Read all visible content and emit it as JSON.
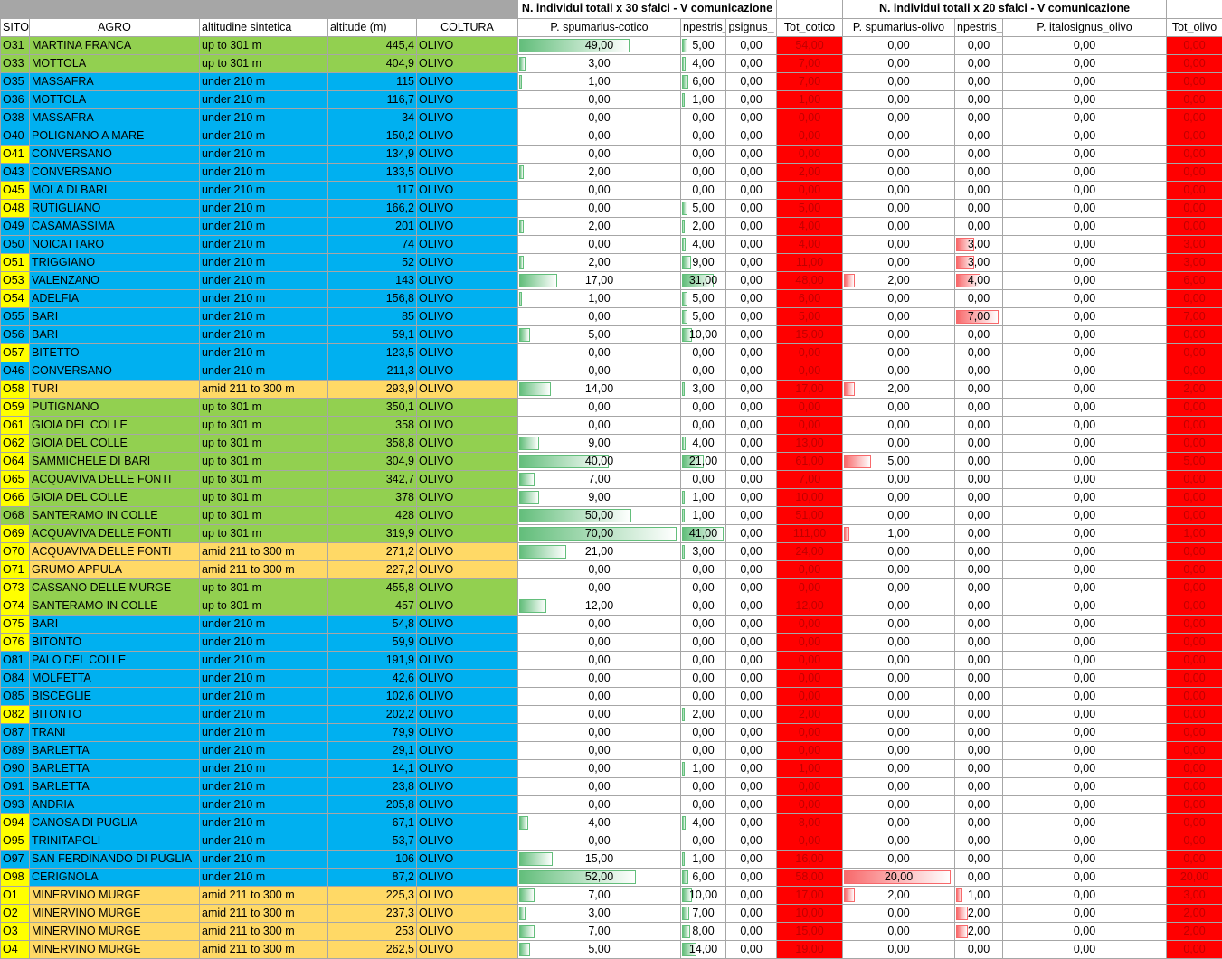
{
  "group_headers": {
    "cotico": "N. individui totali x 30 sfalci - V comunicazione",
    "olivo": "N. individui totali x 20 sfalci - V comunicazione"
  },
  "columns": [
    "SITO",
    "AGRO",
    "altitudine sintetica",
    "altitude (m)",
    "COLTURA",
    "P. spumarius-cotico",
    "npestris_",
    "psignus_",
    "Tot_cotico",
    "P. spumarius-olivo",
    "npestris_",
    "P. italosignus_olivo",
    "Tot_olivo"
  ],
  "colors": {
    "green": "#92d050",
    "blue": "#00b0f0",
    "orange": "#ffd966",
    "yellow": "#ffff00",
    "red": "#ff0000"
  },
  "bar_max": {
    "spc": 70,
    "c2": 41,
    "spo": 20,
    "o2": 7
  },
  "rows": [
    {
      "sito": "O31",
      "agro": "MARTINA FRANCA",
      "alt": "up to 301 m",
      "m": "445,4",
      "colt": "OLIVO",
      "spc": "49,00",
      "c2": "5,00",
      "c3": "0,00",
      "tc": "54,00",
      "spo": "0,00",
      "o2": "0,00",
      "o3": "0,00",
      "to": "0,00",
      "color": "green",
      "sc": "green"
    },
    {
      "sito": "O33",
      "agro": "MOTTOLA",
      "alt": "up to 301 m",
      "m": "404,9",
      "colt": "OLIVO",
      "spc": "3,00",
      "c2": "4,00",
      "c3": "0,00",
      "tc": "7,00",
      "spo": "0,00",
      "o2": "0,00",
      "o3": "0,00",
      "to": "0,00",
      "color": "green",
      "sc": "green"
    },
    {
      "sito": "O35",
      "agro": "MASSAFRA",
      "alt": "under 210 m",
      "m": "115",
      "colt": "OLIVO",
      "spc": "1,00",
      "c2": "6,00",
      "c3": "0,00",
      "tc": "7,00",
      "spo": "0,00",
      "o2": "0,00",
      "o3": "0,00",
      "to": "0,00",
      "color": "blue",
      "sc": "blue"
    },
    {
      "sito": "O36",
      "agro": "MOTTOLA",
      "alt": "under 210 m",
      "m": "116,7",
      "colt": "OLIVO",
      "spc": "0,00",
      "c2": "1,00",
      "c3": "0,00",
      "tc": "1,00",
      "spo": "0,00",
      "o2": "0,00",
      "o3": "0,00",
      "to": "0,00",
      "color": "blue",
      "sc": "blue"
    },
    {
      "sito": "O38",
      "agro": "MASSAFRA",
      "alt": "under 210 m",
      "m": "34",
      "colt": "OLIVO",
      "spc": "0,00",
      "c2": "0,00",
      "c3": "0,00",
      "tc": "0,00",
      "spo": "0,00",
      "o2": "0,00",
      "o3": "0,00",
      "to": "0,00",
      "color": "blue",
      "sc": "blue"
    },
    {
      "sito": "O40",
      "agro": "POLIGNANO A MARE",
      "alt": "under 210 m",
      "m": "150,2",
      "colt": "OLIVO",
      "spc": "0,00",
      "c2": "0,00",
      "c3": "0,00",
      "tc": "0,00",
      "spo": "0,00",
      "o2": "0,00",
      "o3": "0,00",
      "to": "0,00",
      "color": "blue",
      "sc": "blue"
    },
    {
      "sito": "O41",
      "agro": "CONVERSANO",
      "alt": "under 210 m",
      "m": "134,9",
      "colt": "OLIVO",
      "spc": "0,00",
      "c2": "0,00",
      "c3": "0,00",
      "tc": "0,00",
      "spo": "0,00",
      "o2": "0,00",
      "o3": "0,00",
      "to": "0,00",
      "color": "blue",
      "sc": "yellow"
    },
    {
      "sito": "O43",
      "agro": "CONVERSANO",
      "alt": "under 210 m",
      "m": "133,5",
      "colt": "OLIVO",
      "spc": "2,00",
      "c2": "0,00",
      "c3": "0,00",
      "tc": "2,00",
      "spo": "0,00",
      "o2": "0,00",
      "o3": "0,00",
      "to": "0,00",
      "color": "blue",
      "sc": "blue"
    },
    {
      "sito": "O45",
      "agro": "MOLA DI BARI",
      "alt": "under 210 m",
      "m": "117",
      "colt": "OLIVO",
      "spc": "0,00",
      "c2": "0,00",
      "c3": "0,00",
      "tc": "0,00",
      "spo": "0,00",
      "o2": "0,00",
      "o3": "0,00",
      "to": "0,00",
      "color": "blue",
      "sc": "yellow"
    },
    {
      "sito": "O48",
      "agro": "RUTIGLIANO",
      "alt": "under 210 m",
      "m": "166,2",
      "colt": "OLIVO",
      "spc": "0,00",
      "c2": "5,00",
      "c3": "0,00",
      "tc": "5,00",
      "spo": "0,00",
      "o2": "0,00",
      "o3": "0,00",
      "to": "0,00",
      "color": "blue",
      "sc": "yellow"
    },
    {
      "sito": "O49",
      "agro": "CASAMASSIMA",
      "alt": "under 210 m",
      "m": "201",
      "colt": "OLIVO",
      "spc": "2,00",
      "c2": "2,00",
      "c3": "0,00",
      "tc": "4,00",
      "spo": "0,00",
      "o2": "0,00",
      "o3": "0,00",
      "to": "0,00",
      "color": "blue",
      "sc": "blue"
    },
    {
      "sito": "O50",
      "agro": "NOICATTARO",
      "alt": "under 210 m",
      "m": "74",
      "colt": "OLIVO",
      "spc": "0,00",
      "c2": "4,00",
      "c3": "0,00",
      "tc": "4,00",
      "spo": "0,00",
      "o2": "3,00",
      "o3": "0,00",
      "to": "3,00",
      "color": "blue",
      "sc": "blue"
    },
    {
      "sito": "O51",
      "agro": "TRIGGIANO",
      "alt": "under 210 m",
      "m": "52",
      "colt": "OLIVO",
      "spc": "2,00",
      "c2": "9,00",
      "c3": "0,00",
      "tc": "11,00",
      "spo": "0,00",
      "o2": "3,00",
      "o3": "0,00",
      "to": "3,00",
      "color": "blue",
      "sc": "yellow"
    },
    {
      "sito": "O53",
      "agro": "VALENZANO",
      "alt": "under 210 m",
      "m": "143",
      "colt": "OLIVO",
      "spc": "17,00",
      "c2": "31,00",
      "c3": "0,00",
      "tc": "48,00",
      "spo": "2,00",
      "o2": "4,00",
      "o3": "0,00",
      "to": "6,00",
      "color": "blue",
      "sc": "yellow"
    },
    {
      "sito": "O54",
      "agro": "ADELFIA",
      "alt": "under 210 m",
      "m": "156,8",
      "colt": "OLIVO",
      "spc": "1,00",
      "c2": "5,00",
      "c3": "0,00",
      "tc": "6,00",
      "spo": "0,00",
      "o2": "0,00",
      "o3": "0,00",
      "to": "0,00",
      "color": "blue",
      "sc": "yellow"
    },
    {
      "sito": "O55",
      "agro": "BARI",
      "alt": "under 210 m",
      "m": "85",
      "colt": "OLIVO",
      "spc": "0,00",
      "c2": "5,00",
      "c3": "0,00",
      "tc": "5,00",
      "spo": "0,00",
      "o2": "7,00",
      "o3": "0,00",
      "to": "7,00",
      "color": "blue",
      "sc": "blue"
    },
    {
      "sito": "O56",
      "agro": "BARI",
      "alt": "under 210 m",
      "m": "59,1",
      "colt": "OLIVO",
      "spc": "5,00",
      "c2": "10,00",
      "c3": "0,00",
      "tc": "15,00",
      "spo": "0,00",
      "o2": "0,00",
      "o3": "0,00",
      "to": "0,00",
      "color": "blue",
      "sc": "blue"
    },
    {
      "sito": "O57",
      "agro": "BITETTO",
      "alt": "under 210 m",
      "m": "123,5",
      "colt": "OLIVO",
      "spc": "0,00",
      "c2": "0,00",
      "c3": "0,00",
      "tc": "0,00",
      "spo": "0,00",
      "o2": "0,00",
      "o3": "0,00",
      "to": "0,00",
      "color": "blue",
      "sc": "yellow"
    },
    {
      "sito": "O46",
      "agro": "CONVERSANO",
      "alt": "under 210 m",
      "m": "211,3",
      "colt": "OLIVO",
      "spc": "0,00",
      "c2": "0,00",
      "c3": "0,00",
      "tc": "0,00",
      "spo": "0,00",
      "o2": "0,00",
      "o3": "0,00",
      "to": "0,00",
      "color": "blue",
      "sc": "blue"
    },
    {
      "sito": "O58",
      "agro": "TURI",
      "alt": "amid 211 to 300 m",
      "m": "293,9",
      "colt": "OLIVO",
      "spc": "14,00",
      "c2": "3,00",
      "c3": "0,00",
      "tc": "17,00",
      "spo": "2,00",
      "o2": "0,00",
      "o3": "0,00",
      "to": "2,00",
      "color": "orange",
      "sc": "yellow"
    },
    {
      "sito": "O59",
      "agro": "PUTIGNANO",
      "alt": "up to 301 m",
      "m": "350,1",
      "colt": "OLIVO",
      "spc": "0,00",
      "c2": "0,00",
      "c3": "0,00",
      "tc": "0,00",
      "spo": "0,00",
      "o2": "0,00",
      "o3": "0,00",
      "to": "0,00",
      "color": "green",
      "sc": "yellow"
    },
    {
      "sito": "O61",
      "agro": "GIOIA DEL COLLE",
      "alt": "up to 301 m",
      "m": "358",
      "colt": "OLIVO",
      "spc": "0,00",
      "c2": "0,00",
      "c3": "0,00",
      "tc": "0,00",
      "spo": "0,00",
      "o2": "0,00",
      "o3": "0,00",
      "to": "0,00",
      "color": "green",
      "sc": "yellow"
    },
    {
      "sito": "O62",
      "agro": "GIOIA DEL COLLE",
      "alt": "up to 301 m",
      "m": "358,8",
      "colt": "OLIVO",
      "spc": "9,00",
      "c2": "4,00",
      "c3": "0,00",
      "tc": "13,00",
      "spo": "0,00",
      "o2": "0,00",
      "o3": "0,00",
      "to": "0,00",
      "color": "green",
      "sc": "yellow"
    },
    {
      "sito": "O64",
      "agro": "SAMMICHELE DI BARI",
      "alt": "up to 301 m",
      "m": "304,9",
      "colt": "OLIVO",
      "spc": "40,00",
      "c2": "21,00",
      "c3": "0,00",
      "tc": "61,00",
      "spo": "5,00",
      "o2": "0,00",
      "o3": "0,00",
      "to": "5,00",
      "color": "green",
      "sc": "yellow"
    },
    {
      "sito": "O65",
      "agro": "ACQUAVIVA DELLE FONTI",
      "alt": "up to 301 m",
      "m": "342,7",
      "colt": "OLIVO",
      "spc": "7,00",
      "c2": "0,00",
      "c3": "0,00",
      "tc": "7,00",
      "spo": "0,00",
      "o2": "0,00",
      "o3": "0,00",
      "to": "0,00",
      "color": "green",
      "sc": "yellow"
    },
    {
      "sito": "O66",
      "agro": "GIOIA DEL COLLE",
      "alt": "up to 301 m",
      "m": "378",
      "colt": "OLIVO",
      "spc": "9,00",
      "c2": "1,00",
      "c3": "0,00",
      "tc": "10,00",
      "spo": "0,00",
      "o2": "0,00",
      "o3": "0,00",
      "to": "0,00",
      "color": "green",
      "sc": "yellow"
    },
    {
      "sito": "O68",
      "agro": "SANTERAMO IN COLLE",
      "alt": "up to 301 m",
      "m": "428",
      "colt": "OLIVO",
      "spc": "50,00",
      "c2": "1,00",
      "c3": "0,00",
      "tc": "51,00",
      "spo": "0,00",
      "o2": "0,00",
      "o3": "0,00",
      "to": "0,00",
      "color": "green",
      "sc": "green"
    },
    {
      "sito": "O69",
      "agro": "ACQUAVIVA DELLE FONTI",
      "alt": "up to 301 m",
      "m": "319,9",
      "colt": "OLIVO",
      "spc": "70,00",
      "c2": "41,00",
      "c3": "0,00",
      "tc": "111,00",
      "spo": "1,00",
      "o2": "0,00",
      "o3": "0,00",
      "to": "1,00",
      "color": "green",
      "sc": "yellow"
    },
    {
      "sito": "O70",
      "agro": "ACQUAVIVA DELLE FONTI",
      "alt": "amid 211 to 300 m",
      "m": "271,2",
      "colt": "OLIVO",
      "spc": "21,00",
      "c2": "3,00",
      "c3": "0,00",
      "tc": "24,00",
      "spo": "0,00",
      "o2": "0,00",
      "o3": "0,00",
      "to": "0,00",
      "color": "orange",
      "sc": "yellow"
    },
    {
      "sito": "O71",
      "agro": "GRUMO APPULA",
      "alt": "amid 211 to 300 m",
      "m": "227,2",
      "colt": "OLIVO",
      "spc": "0,00",
      "c2": "0,00",
      "c3": "0,00",
      "tc": "0,00",
      "spo": "0,00",
      "o2": "0,00",
      "o3": "0,00",
      "to": "0,00",
      "color": "orange",
      "sc": "yellow"
    },
    {
      "sito": "O73",
      "agro": "CASSANO DELLE MURGE",
      "alt": "up to 301 m",
      "m": "455,8",
      "colt": "OLIVO",
      "spc": "0,00",
      "c2": "0,00",
      "c3": "0,00",
      "tc": "0,00",
      "spo": "0,00",
      "o2": "0,00",
      "o3": "0,00",
      "to": "0,00",
      "color": "green",
      "sc": "yellow"
    },
    {
      "sito": "O74",
      "agro": "SANTERAMO IN COLLE",
      "alt": "up to 301 m",
      "m": "457",
      "colt": "OLIVO",
      "spc": "12,00",
      "c2": "0,00",
      "c3": "0,00",
      "tc": "12,00",
      "spo": "0,00",
      "o2": "0,00",
      "o3": "0,00",
      "to": "0,00",
      "color": "green",
      "sc": "yellow"
    },
    {
      "sito": "O75",
      "agro": "BARI",
      "alt": "under 210 m",
      "m": "54,8",
      "colt": "OLIVO",
      "spc": "0,00",
      "c2": "0,00",
      "c3": "0,00",
      "tc": "0,00",
      "spo": "0,00",
      "o2": "0,00",
      "o3": "0,00",
      "to": "0,00",
      "color": "blue",
      "sc": "yellow"
    },
    {
      "sito": "O76",
      "agro": "BITONTO",
      "alt": "under 210 m",
      "m": "59,9",
      "colt": "OLIVO",
      "spc": "0,00",
      "c2": "0,00",
      "c3": "0,00",
      "tc": "0,00",
      "spo": "0,00",
      "o2": "0,00",
      "o3": "0,00",
      "to": "0,00",
      "color": "blue",
      "sc": "yellow"
    },
    {
      "sito": "O81",
      "agro": "PALO DEL COLLE",
      "alt": "under 210 m",
      "m": "191,9",
      "colt": "OLIVO",
      "spc": "0,00",
      "c2": "0,00",
      "c3": "0,00",
      "tc": "0,00",
      "spo": "0,00",
      "o2": "0,00",
      "o3": "0,00",
      "to": "0,00",
      "color": "blue",
      "sc": "blue"
    },
    {
      "sito": "O84",
      "agro": "MOLFETTA",
      "alt": "under 210 m",
      "m": "42,6",
      "colt": "OLIVO",
      "spc": "0,00",
      "c2": "0,00",
      "c3": "0,00",
      "tc": "0,00",
      "spo": "0,00",
      "o2": "0,00",
      "o3": "0,00",
      "to": "0,00",
      "color": "blue",
      "sc": "blue"
    },
    {
      "sito": "O85",
      "agro": "BISCEGLIE",
      "alt": "under 210 m",
      "m": "102,6",
      "colt": "OLIVO",
      "spc": "0,00",
      "c2": "0,00",
      "c3": "0,00",
      "tc": "0,00",
      "spo": "0,00",
      "o2": "0,00",
      "o3": "0,00",
      "to": "0,00",
      "color": "blue",
      "sc": "blue"
    },
    {
      "sito": "O82",
      "agro": "BITONTO",
      "alt": "under 210 m",
      "m": "202,2",
      "colt": "OLIVO",
      "spc": "0,00",
      "c2": "2,00",
      "c3": "0,00",
      "tc": "2,00",
      "spo": "0,00",
      "o2": "0,00",
      "o3": "0,00",
      "to": "0,00",
      "color": "blue",
      "sc": "yellow"
    },
    {
      "sito": "O87",
      "agro": "TRANI",
      "alt": "under 210 m",
      "m": "79,9",
      "colt": "OLIVO",
      "spc": "0,00",
      "c2": "0,00",
      "c3": "0,00",
      "tc": "0,00",
      "spo": "0,00",
      "o2": "0,00",
      "o3": "0,00",
      "to": "0,00",
      "color": "blue",
      "sc": "blue"
    },
    {
      "sito": "O89",
      "agro": "BARLETTA",
      "alt": "under 210 m",
      "m": "29,1",
      "colt": "OLIVO",
      "spc": "0,00",
      "c2": "0,00",
      "c3": "0,00",
      "tc": "0,00",
      "spo": "0,00",
      "o2": "0,00",
      "o3": "0,00",
      "to": "0,00",
      "color": "blue",
      "sc": "blue"
    },
    {
      "sito": "O90",
      "agro": "BARLETTA",
      "alt": "under 210 m",
      "m": "14,1",
      "colt": "OLIVO",
      "spc": "0,00",
      "c2": "1,00",
      "c3": "0,00",
      "tc": "1,00",
      "spo": "0,00",
      "o2": "0,00",
      "o3": "0,00",
      "to": "0,00",
      "color": "blue",
      "sc": "blue"
    },
    {
      "sito": "O91",
      "agro": "BARLETTA",
      "alt": "under 210 m",
      "m": "23,8",
      "colt": "OLIVO",
      "spc": "0,00",
      "c2": "0,00",
      "c3": "0,00",
      "tc": "0,00",
      "spo": "0,00",
      "o2": "0,00",
      "o3": "0,00",
      "to": "0,00",
      "color": "blue",
      "sc": "blue"
    },
    {
      "sito": "O93",
      "agro": "ANDRIA",
      "alt": "under 210 m",
      "m": "205,8",
      "colt": "OLIVO",
      "spc": "0,00",
      "c2": "0,00",
      "c3": "0,00",
      "tc": "0,00",
      "spo": "0,00",
      "o2": "0,00",
      "o3": "0,00",
      "to": "0,00",
      "color": "blue",
      "sc": "blue"
    },
    {
      "sito": "O94",
      "agro": "CANOSA DI PUGLIA",
      "alt": "under 210 m",
      "m": "67,1",
      "colt": "OLIVO",
      "spc": "4,00",
      "c2": "4,00",
      "c3": "0,00",
      "tc": "8,00",
      "spo": "0,00",
      "o2": "0,00",
      "o3": "0,00",
      "to": "0,00",
      "color": "blue",
      "sc": "yellow"
    },
    {
      "sito": "O95",
      "agro": "TRINITAPOLI",
      "alt": "under 210 m",
      "m": "53,7",
      "colt": "OLIVO",
      "spc": "0,00",
      "c2": "0,00",
      "c3": "0,00",
      "tc": "0,00",
      "spo": "0,00",
      "o2": "0,00",
      "o3": "0,00",
      "to": "0,00",
      "color": "blue",
      "sc": "yellow"
    },
    {
      "sito": "O97",
      "agro": "SAN FERDINANDO DI PUGLIA",
      "alt": "under 210 m",
      "m": "106",
      "colt": "OLIVO",
      "spc": "15,00",
      "c2": "1,00",
      "c3": "0,00",
      "tc": "16,00",
      "spo": "0,00",
      "o2": "0,00",
      "o3": "0,00",
      "to": "0,00",
      "color": "blue",
      "sc": "blue"
    },
    {
      "sito": "O98",
      "agro": "CERIGNOLA",
      "alt": "under 210 m",
      "m": "87,2",
      "colt": "OLIVO",
      "spc": "52,00",
      "c2": "6,00",
      "c3": "0,00",
      "tc": "58,00",
      "spo": "20,00",
      "o2": "0,00",
      "o3": "0,00",
      "to": "20,00",
      "color": "blue",
      "sc": "yellow"
    },
    {
      "sito": "O1",
      "agro": "MINERVINO MURGE",
      "alt": "amid 211 to 300 m",
      "m": "225,3",
      "colt": "OLIVO",
      "spc": "7,00",
      "c2": "10,00",
      "c3": "0,00",
      "tc": "17,00",
      "spo": "2,00",
      "o2": "1,00",
      "o3": "0,00",
      "to": "3,00",
      "color": "orange",
      "sc": "yellow"
    },
    {
      "sito": "O2",
      "agro": "MINERVINO MURGE",
      "alt": "amid 211 to 300 m",
      "m": "237,3",
      "colt": "OLIVO",
      "spc": "3,00",
      "c2": "7,00",
      "c3": "0,00",
      "tc": "10,00",
      "spo": "0,00",
      "o2": "2,00",
      "o3": "0,00",
      "to": "2,00",
      "color": "orange",
      "sc": "yellow"
    },
    {
      "sito": "O3",
      "agro": "MINERVINO MURGE",
      "alt": "amid 211 to 300 m",
      "m": "253",
      "colt": "OLIVO",
      "spc": "7,00",
      "c2": "8,00",
      "c3": "0,00",
      "tc": "15,00",
      "spo": "0,00",
      "o2": "2,00",
      "o3": "0,00",
      "to": "2,00",
      "color": "orange",
      "sc": "yellow"
    },
    {
      "sito": "O4",
      "agro": "MINERVINO MURGE",
      "alt": "amid 211 to 300 m",
      "m": "262,5",
      "colt": "OLIVO",
      "spc": "5,00",
      "c2": "14,00",
      "c3": "0,00",
      "tc": "19,00",
      "spo": "0,00",
      "o2": "0,00",
      "o3": "0,00",
      "to": "0,00",
      "color": "orange",
      "sc": "yellow"
    }
  ]
}
